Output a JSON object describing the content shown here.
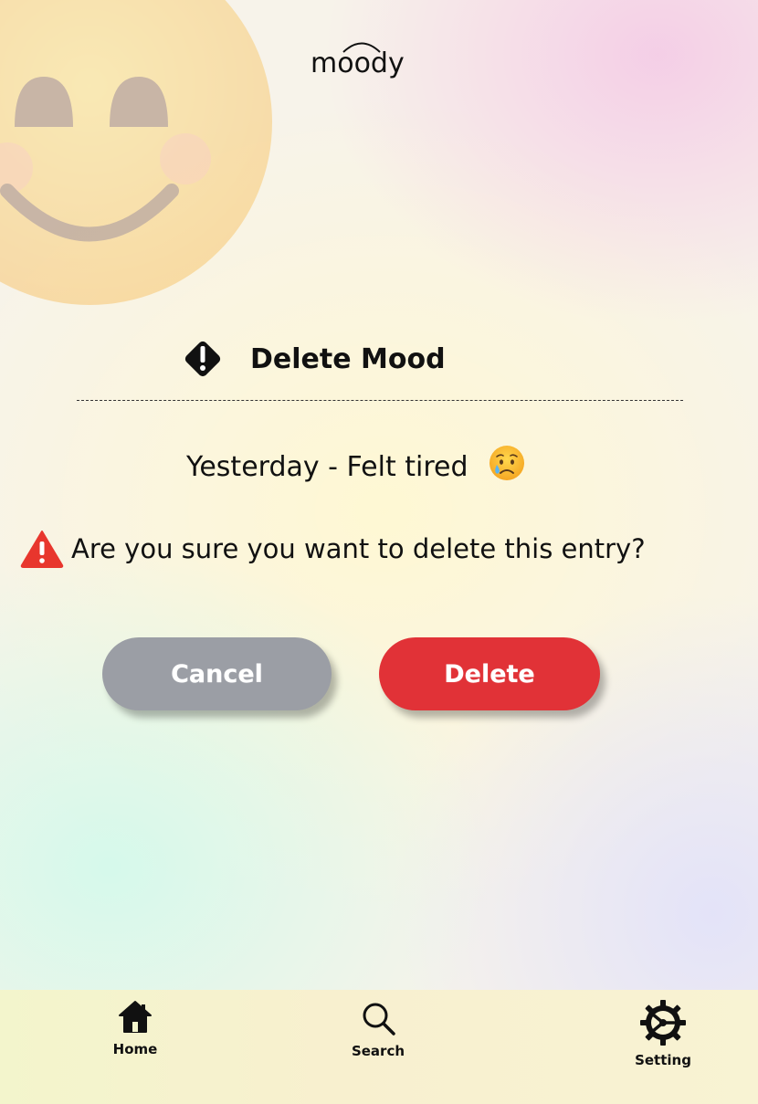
{
  "app": {
    "logo_text": "moody"
  },
  "dialog": {
    "title": "Delete Mood",
    "entry_text": "Yesterday - Felt tired",
    "entry_emoji": "sad-tear-face-icon",
    "question": "Are you sure you want to delete this entry?",
    "cancel_label": "Cancel",
    "delete_label": "Delete"
  },
  "nav": {
    "items": [
      {
        "label": "Home",
        "icon": "home-icon"
      },
      {
        "label": "Search",
        "icon": "search-icon"
      },
      {
        "label": "Setting",
        "icon": "gear-icon"
      }
    ]
  },
  "colors": {
    "delete": "#e13237",
    "cancel": "#9b9ea5",
    "warning": "#e8362d"
  }
}
